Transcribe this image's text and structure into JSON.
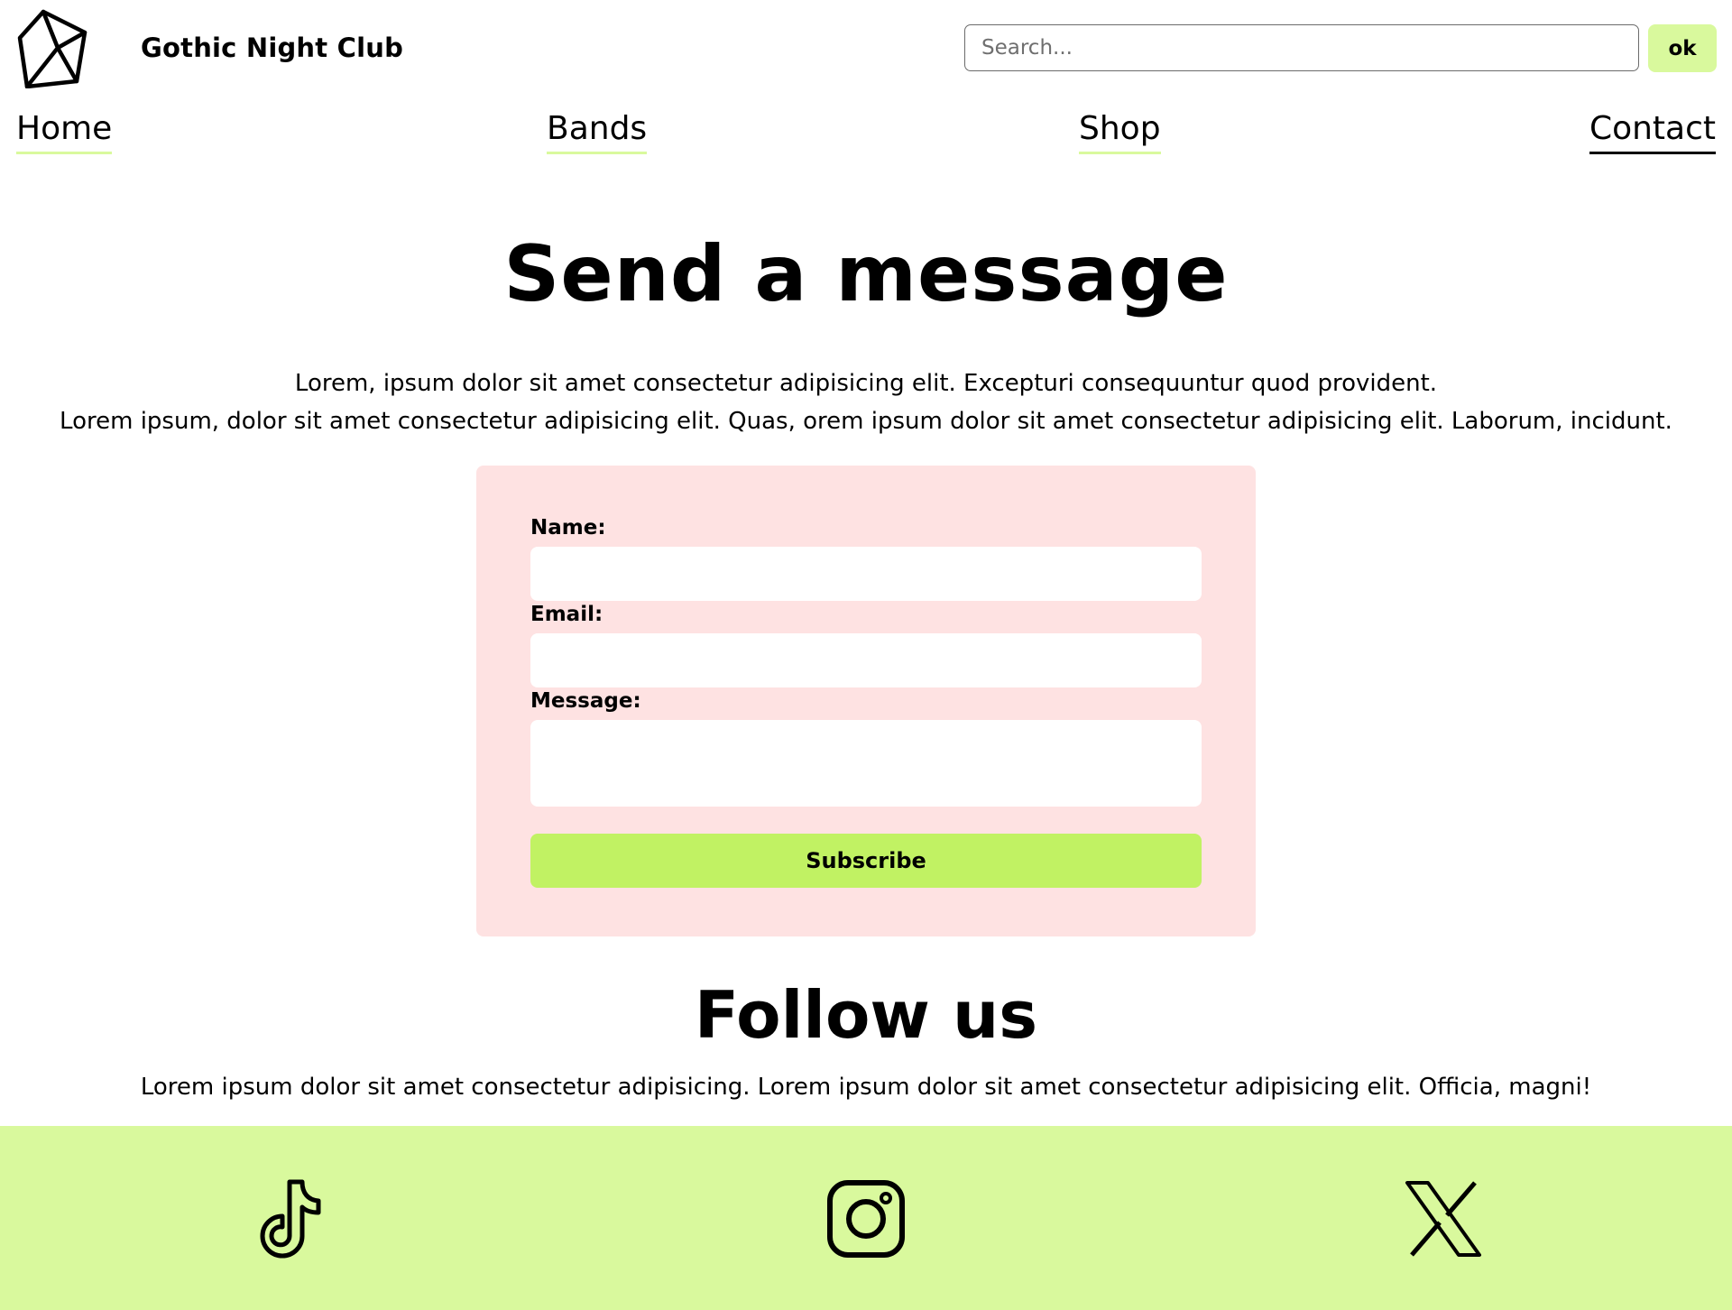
{
  "header": {
    "logo_icon": "gem-icon",
    "site_name": "Gothic Night Club",
    "search": {
      "placeholder": "Search...",
      "value": "",
      "button_label": "ok"
    }
  },
  "nav": {
    "items": [
      {
        "label": "Home",
        "active": false
      },
      {
        "label": "Bands",
        "active": false
      },
      {
        "label": "Shop",
        "active": false
      },
      {
        "label": "Contact",
        "active": true
      }
    ]
  },
  "main": {
    "title": "Send a message",
    "intro": [
      "Lorem, ipsum dolor sit amet consectetur adipisicing elit. Excepturi consequuntur quod provident.",
      "Lorem ipsum, dolor sit amet consectetur adipisicing elit. Quas, orem ipsum dolor sit amet consectetur adipisicing elit. Laborum, incidunt."
    ],
    "form": {
      "name_label": "Name:",
      "name_value": "",
      "email_label": "Email:",
      "email_value": "",
      "message_label": "Message:",
      "message_value": "",
      "submit_label": "Subscribe"
    }
  },
  "follow": {
    "title": "Follow us",
    "text": "Lorem ipsum dolor sit amet consectetur adipisicing. Lorem ipsum dolor sit amet consectetur adipisicing elit. Officia, magni!"
  },
  "social": {
    "icons": [
      "tiktok-icon",
      "instagram-icon",
      "x-icon"
    ]
  },
  "colors": {
    "accent": "#d9f99d",
    "button": "#c1f263",
    "form_background": "#fee2e2",
    "text": "#000000",
    "background": "#ffffff"
  }
}
